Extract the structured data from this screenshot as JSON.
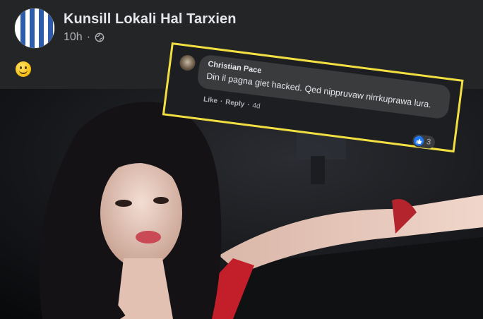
{
  "post": {
    "page_name": "Kunsill Lokali Hal Tarxien",
    "time": "10h",
    "separator": "·",
    "privacy_icon": "globe-icon",
    "emoji_icon": "slightly-smiling-emoji"
  },
  "comment": {
    "author": "Christian Pace",
    "text": "Din il pagna giet hacked. Qed nippruvaw nirrkuprawa lura.",
    "like_label": "Like",
    "dot": "·",
    "reply_label": "Reply",
    "time": "4d",
    "reaction_icon": "like-icon",
    "reaction_count": "3",
    "highlight_color": "#f2e043"
  },
  "colors": {
    "background": "#242526",
    "text_primary": "#e4e6eb",
    "text_secondary": "#b0b3b8",
    "accent_like": "#2078f4",
    "photo_accent": "#c21f2a"
  }
}
